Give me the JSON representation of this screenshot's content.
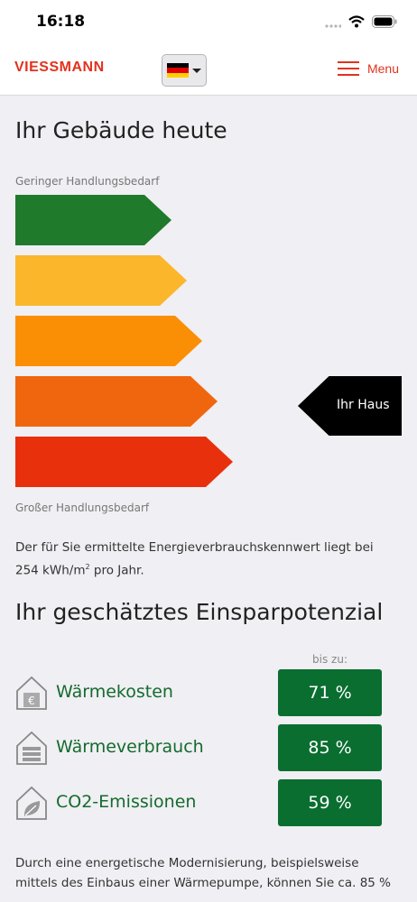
{
  "status_bar": {
    "time": "16:18"
  },
  "header": {
    "logo": "VIESSMANN",
    "menu_label": "Menu",
    "flag_colors": [
      "#000000",
      "#dd0000",
      "#ffce00"
    ]
  },
  "building": {
    "title": "Ihr Gebäude heute",
    "top_label": "Geringer Handlungsbedarf",
    "bottom_label": "Großer Handlungsbedarf",
    "bar_colors": [
      "#207a2c",
      "#fbb62b",
      "#fa8f06",
      "#f0660e",
      "#e8300c"
    ],
    "marker_label": "Ihr Haus",
    "marker_level": 4,
    "description_text": "Der für Sie ermittelte Energieverbrauchskennwert liegt bei",
    "description_value": "254 kWh/m",
    "description_sup": "2",
    "description_suffix": " pro Jahr."
  },
  "savings": {
    "title": "Ihr geschätztes Einsparpotenzial",
    "up_to_label": "bis zu:",
    "items": [
      {
        "icon": "house-euro-icon",
        "label": "Wärmekosten",
        "value": "71 %"
      },
      {
        "icon": "house-radiator-icon",
        "label": "Wärmeverbrauch",
        "value": "85 %"
      },
      {
        "icon": "house-leaf-icon",
        "label": "CO2-Emissionen",
        "value": "59 %"
      }
    ],
    "accent_color": "#0a6e30"
  },
  "footer_text_line1": "Durch eine energetische Modernisierung, beispielsweise",
  "footer_text_line2": "mittels des Einbaus einer Wärmepumpe, können Sie ca. 85 %"
}
